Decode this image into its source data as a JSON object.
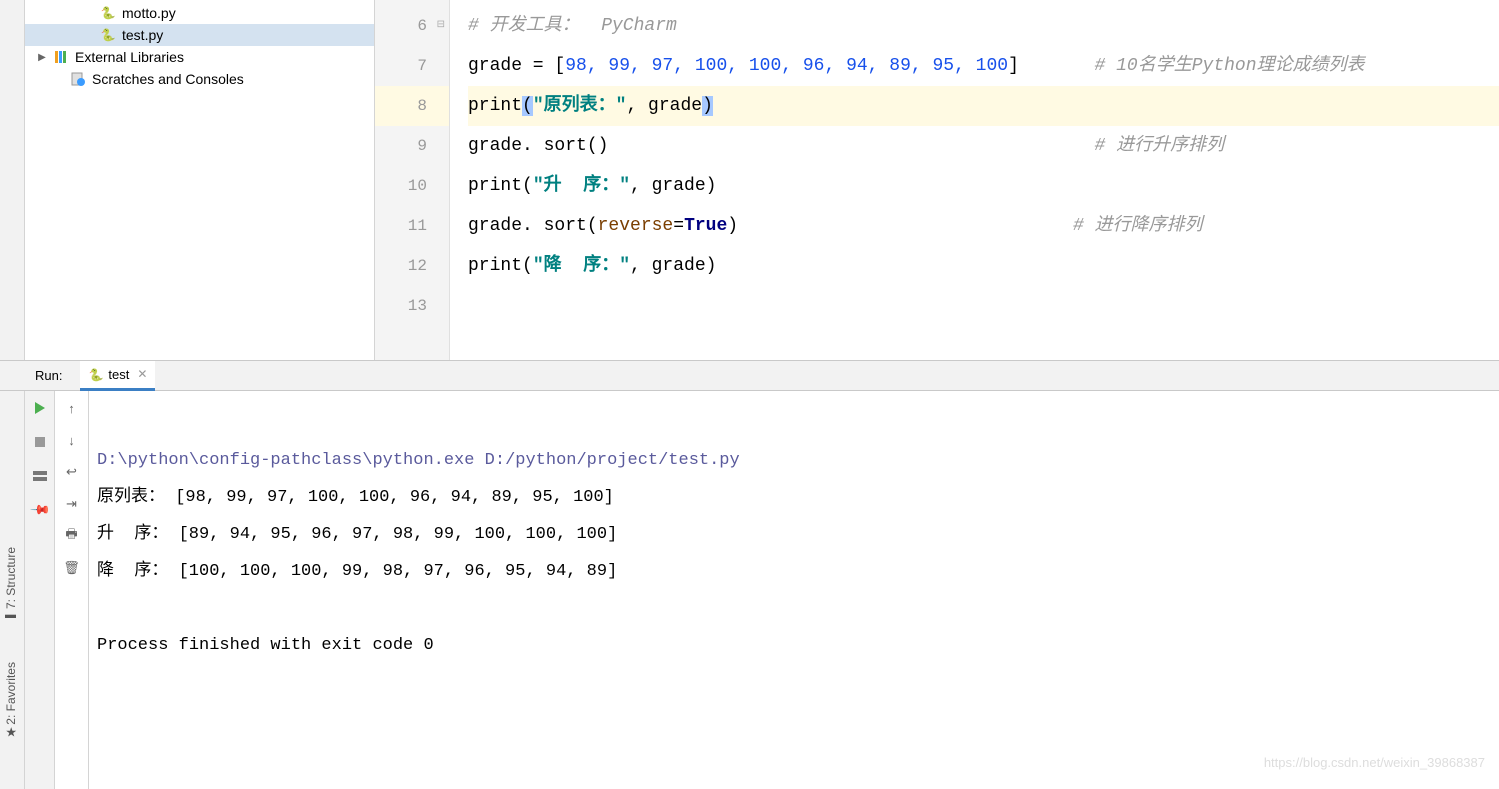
{
  "tree": {
    "motto": "motto.py",
    "test": "test.py",
    "external": "External Libraries",
    "scratches": "Scratches and Consoles"
  },
  "editor": {
    "lines": {
      "l6": "# 开发工具：  PyCharm",
      "l7a": "grade = [",
      "l7nums": "98, 99, 97, 100, 100, 96, 94, 89, 95, 100",
      "l7b": "]       ",
      "l7c": "# 10名学生Python理论成绩列表",
      "l8a": "print",
      "l8p1": "(",
      "l8s": "\"原列表：\"",
      "l8m": ", grade",
      "l8p2": ")",
      "l9": "grade. sort()                                             ",
      "l9c": "# 进行升序排列",
      "l10a": "print(",
      "l10s": "\"升  序：\"",
      "l10b": ", grade)",
      "l11a": "grade. sort(",
      "l11p": "reverse",
      "l11e": "=",
      "l11k": "True",
      "l11b": ")                               ",
      "l11c": "# 进行降序排列",
      "l12a": "print(",
      "l12s": "\"降  序：\"",
      "l12b": ", grade)"
    },
    "gutter": [
      "6",
      "7",
      "8",
      "9",
      "10",
      "11",
      "12",
      "13"
    ]
  },
  "run": {
    "label": "Run:",
    "tab": "test",
    "output": {
      "cmd": "D:\\python\\config-pathclass\\python.exe D:/python/project/test.py",
      "o1": "原列表： [98, 99, 97, 100, 100, 96, 94, 89, 95, 100]",
      "o2": "升  序： [89, 94, 95, 96, 97, 98, 99, 100, 100, 100]",
      "o3": "降  序： [100, 100, 100, 99, 98, 97, 96, 95, 94, 89]",
      "exit": "Process finished with exit code 0"
    }
  },
  "sidetabs": {
    "structure": "7: Structure",
    "favorites": "2: Favorites"
  },
  "watermark": "https://blog.csdn.net/weixin_39868387"
}
